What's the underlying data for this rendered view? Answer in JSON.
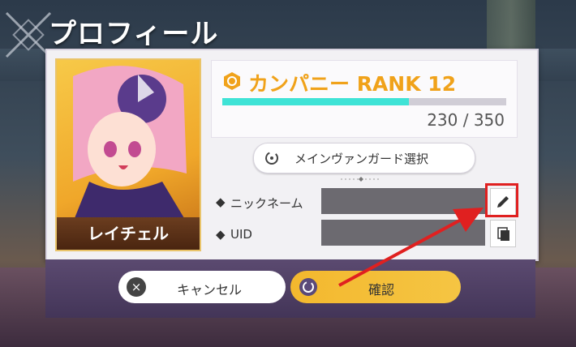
{
  "header": {
    "title": "プロフィール"
  },
  "portrait": {
    "name": "レイチェル"
  },
  "rank": {
    "label": "カンパニー RANK 12",
    "exp_text": "230 / 350",
    "exp_fraction": 0.657
  },
  "vanguard_button": {
    "label": "メインヴァンガード選択"
  },
  "fields": {
    "nickname_label": "ニックネーム",
    "uid_label": "UID"
  },
  "footer": {
    "cancel_label": "キャンセル",
    "ok_label": "確認",
    "cancel_icon": "×"
  },
  "colors": {
    "accent": "#f0a21a",
    "progress": "#3fe3d6",
    "highlight": "#e02020"
  }
}
